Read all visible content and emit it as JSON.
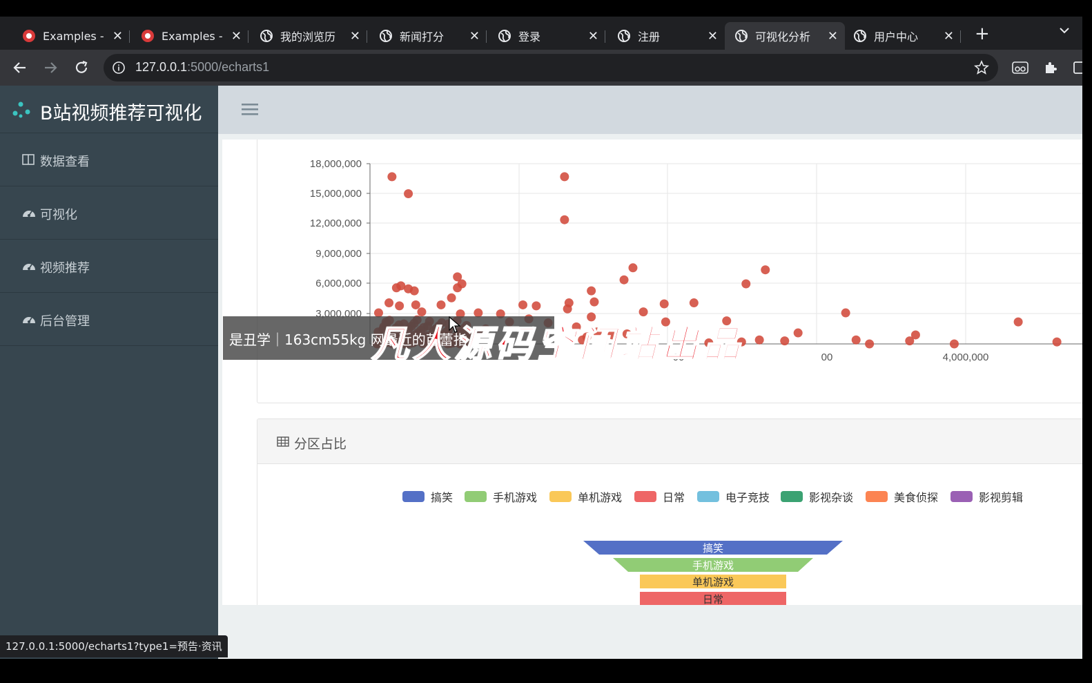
{
  "browser": {
    "tabs": [
      {
        "title": "Examples -",
        "icon": "app-icon"
      },
      {
        "title": "Examples -",
        "icon": "app-icon"
      },
      {
        "title": "我的浏览历",
        "icon": "globe-icon"
      },
      {
        "title": "新闻打分",
        "icon": "globe-icon"
      },
      {
        "title": "登录",
        "icon": "globe-icon"
      },
      {
        "title": "注册",
        "icon": "globe-icon"
      },
      {
        "title": "可视化分析",
        "icon": "globe-icon",
        "active": true
      },
      {
        "title": "用户中心",
        "icon": "globe-icon"
      }
    ],
    "url_host": "127.0.0.1",
    "url_rest": ":5000/echarts1",
    "status_url": "127.0.0.1:5000/echarts1?type1=预告·资讯"
  },
  "sidebar": {
    "brand": "B站视频推荐可视化",
    "items": [
      {
        "label": "数据查看",
        "icon": "columns-icon"
      },
      {
        "label": "可视化",
        "icon": "dashboard-icon"
      },
      {
        "label": "视频推荐",
        "icon": "dashboard-icon"
      },
      {
        "label": "后台管理",
        "icon": "dashboard-icon"
      }
    ]
  },
  "tooltip": "是丑学｜163cm55kg 网最近的芭蕾指",
  "watermark": "凡人源码空间站出品",
  "panel2": {
    "title": "分区占比"
  },
  "chart_data": [
    {
      "type": "scatter",
      "color": "#d14a3b",
      "ylim": [
        0,
        18000000
      ],
      "yticks": [
        "18,000,000",
        "15,000,000",
        "12,000,000",
        "9,000,000",
        "6,000,000",
        "3,000,000"
      ],
      "xticks_visible": [
        "00",
        "00",
        "4,000,000"
      ],
      "points": [
        [
          120000,
          16700000
        ],
        [
          230000,
          15000000
        ],
        [
          1280000,
          16700000
        ],
        [
          1280000,
          12400000
        ],
        [
          560000,
          6700000
        ],
        [
          590000,
          6000000
        ],
        [
          560000,
          5600000
        ],
        [
          520000,
          4600000
        ],
        [
          450000,
          3900000
        ],
        [
          150000,
          5600000
        ],
        [
          180000,
          5800000
        ],
        [
          230000,
          5500000
        ],
        [
          270000,
          5300000
        ],
        [
          100000,
          4100000
        ],
        [
          170000,
          3800000
        ],
        [
          280000,
          3900000
        ],
        [
          320000,
          3200000
        ],
        [
          30000,
          3100000
        ],
        [
          80000,
          2200000
        ],
        [
          60000,
          1500000
        ],
        [
          200000,
          2000000
        ],
        [
          360000,
          1800000
        ],
        [
          420000,
          1500000
        ],
        [
          500000,
          2000000
        ],
        [
          580000,
          3000000
        ],
        [
          700000,
          3100000
        ],
        [
          750000,
          1500000
        ],
        [
          850000,
          3000000
        ],
        [
          910000,
          2200000
        ],
        [
          1000000,
          3900000
        ],
        [
          1040000,
          2500000
        ],
        [
          1090000,
          3800000
        ],
        [
          1170000,
          2100000
        ],
        [
          1310000,
          4100000
        ],
        [
          1300000,
          3500000
        ],
        [
          1360000,
          1700000
        ],
        [
          1460000,
          5300000
        ],
        [
          1480000,
          4200000
        ],
        [
          1460000,
          2700000
        ],
        [
          1680000,
          6400000
        ],
        [
          1740000,
          7600000
        ],
        [
          1810000,
          3200000
        ],
        [
          1950000,
          4000000
        ],
        [
          1960000,
          2200000
        ],
        [
          2150000,
          4100000
        ],
        [
          2370000,
          2300000
        ],
        [
          2500000,
          6000000
        ],
        [
          2630000,
          7400000
        ],
        [
          2850000,
          1100000
        ],
        [
          3170000,
          3100000
        ],
        [
          3240000,
          400000
        ],
        [
          3330000,
          0
        ],
        [
          3600000,
          300000
        ],
        [
          3640000,
          900000
        ],
        [
          3900000,
          0
        ],
        [
          4330000,
          2200000
        ],
        [
          4590000,
          200000
        ],
        [
          2250000,
          100000
        ],
        [
          2470000,
          200000
        ],
        [
          1600000,
          900000
        ],
        [
          640000,
          1000000
        ],
        [
          700000,
          1300000
        ],
        [
          1430000,
          700000
        ],
        [
          1700000,
          1000000
        ],
        [
          1500000,
          1200000
        ],
        [
          1400000,
          400000
        ],
        [
          2590000,
          400000
        ],
        [
          2760000,
          300000
        ]
      ]
    },
    {
      "type": "funnel",
      "legend": [
        {
          "name": "搞笑",
          "color": "#5470c6"
        },
        {
          "name": "手机游戏",
          "color": "#91cc75"
        },
        {
          "name": "单机游戏",
          "color": "#fac858"
        },
        {
          "name": "日常",
          "color": "#ee6666"
        },
        {
          "name": "电子竞技",
          "color": "#73c0de"
        },
        {
          "name": "影视杂谈",
          "color": "#3ba272"
        },
        {
          "name": "美食侦探",
          "color": "#fc8452"
        },
        {
          "name": "影视剪辑",
          "color": "#9a60b4"
        }
      ],
      "visible_stages": [
        {
          "name": "搞笑",
          "color": "#5470c6"
        },
        {
          "name": "手机游戏",
          "color": "#91cc75"
        },
        {
          "name": "单机游戏",
          "color": "#fac858"
        },
        {
          "name": "日常",
          "color": "#ee6666"
        }
      ]
    }
  ]
}
